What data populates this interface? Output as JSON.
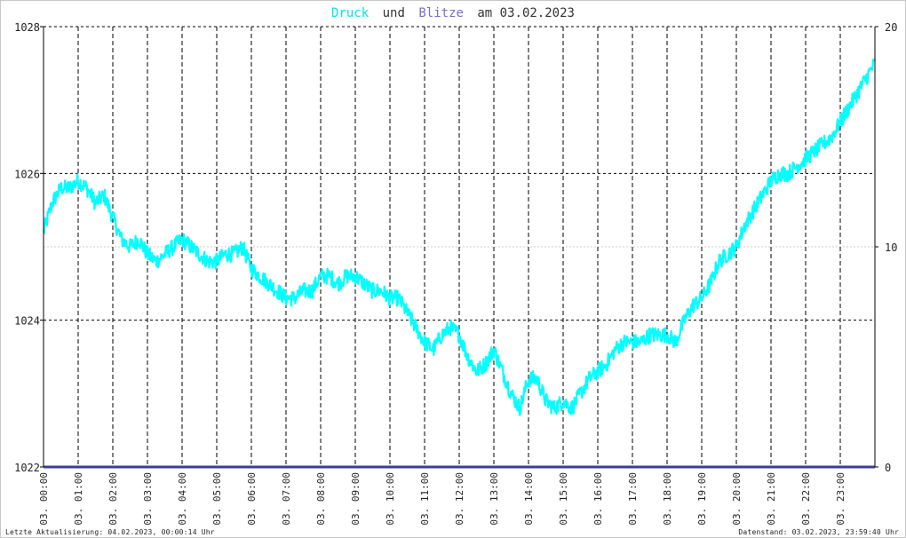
{
  "title": {
    "word1": "Druck",
    "word2": "und",
    "word3": "Blitze",
    "word4": "am 03.02.2023"
  },
  "footer": {
    "left": "Letzte Aktualisierung: 04.02.2023, 00:00:14 Uhr",
    "right": "Datenstand: 03.02.2023, 23:59:40 Uhr"
  },
  "colors": {
    "pressure": "#00ffff",
    "lightning": "#3c3c9a",
    "title_druck": "#00e6e6",
    "title_blitze": "#7b6ccc",
    "grid": "#000000",
    "axis": "#000000"
  },
  "chart_data": {
    "type": "line",
    "title": "Druck und Blitze am 03.02.2023",
    "y_left": {
      "ylim": [
        1022,
        1028
      ],
      "ticks": [
        1022,
        1024,
        1026,
        1028
      ]
    },
    "y_right": {
      "ylim": [
        0,
        20
      ],
      "ticks": [
        0,
        10,
        20
      ]
    },
    "x_ticks": [
      "03. 00:00",
      "03. 01:00",
      "03. 02:00",
      "03. 03:00",
      "03. 04:00",
      "03. 05:00",
      "03. 06:00",
      "03. 07:00",
      "03. 08:00",
      "03. 09:00",
      "03. 10:00",
      "03. 11:00",
      "03. 12:00",
      "03. 13:00",
      "03. 14:00",
      "03. 15:00",
      "03. 16:00",
      "03. 17:00",
      "03. 18:00",
      "03. 19:00",
      "03. 20:00",
      "03. 21:00",
      "03. 22:00",
      "03. 23:00"
    ],
    "grid": true,
    "series": [
      {
        "name": "Druck",
        "axis": "left",
        "x_hours": [
          0.0,
          0.25,
          0.5,
          0.75,
          1.0,
          1.25,
          1.5,
          1.75,
          2.0,
          2.25,
          2.5,
          2.75,
          3.0,
          3.25,
          3.5,
          3.75,
          4.0,
          4.25,
          4.5,
          4.75,
          5.0,
          5.25,
          5.5,
          5.75,
          6.0,
          6.25,
          6.5,
          6.75,
          7.0,
          7.25,
          7.5,
          7.75,
          8.0,
          8.25,
          8.5,
          8.75,
          9.0,
          9.25,
          9.5,
          9.75,
          10.0,
          10.25,
          10.5,
          10.75,
          11.0,
          11.25,
          11.5,
          11.75,
          12.0,
          12.25,
          12.5,
          12.75,
          13.0,
          13.25,
          13.5,
          13.75,
          14.0,
          14.25,
          14.5,
          14.75,
          15.0,
          15.25,
          15.5,
          15.75,
          16.0,
          16.25,
          16.5,
          16.75,
          17.0,
          17.25,
          17.5,
          17.75,
          18.0,
          18.25,
          18.5,
          18.75,
          19.0,
          19.25,
          19.5,
          19.75,
          20.0,
          20.25,
          20.5,
          20.75,
          21.0,
          21.25,
          21.5,
          21.75,
          22.0,
          22.25,
          22.5,
          22.75,
          23.0,
          23.25,
          23.5,
          23.75,
          24.0
        ],
        "values": [
          1025.2,
          1025.6,
          1025.8,
          1025.8,
          1025.9,
          1025.8,
          1025.6,
          1025.7,
          1025.4,
          1025.1,
          1025.0,
          1025.1,
          1024.9,
          1024.8,
          1024.9,
          1025.0,
          1025.1,
          1025.0,
          1024.9,
          1024.8,
          1024.8,
          1024.9,
          1024.9,
          1025.0,
          1024.7,
          1024.6,
          1024.5,
          1024.4,
          1024.3,
          1024.3,
          1024.4,
          1024.4,
          1024.6,
          1024.6,
          1024.5,
          1024.6,
          1024.6,
          1024.5,
          1024.4,
          1024.4,
          1024.3,
          1024.3,
          1024.1,
          1023.9,
          1023.7,
          1023.6,
          1023.8,
          1023.9,
          1023.8,
          1023.5,
          1023.3,
          1023.4,
          1023.6,
          1023.3,
          1023.0,
          1022.8,
          1023.2,
          1023.2,
          1022.9,
          1022.8,
          1022.9,
          1022.8,
          1023.0,
          1023.2,
          1023.3,
          1023.4,
          1023.6,
          1023.7,
          1023.7,
          1023.7,
          1023.8,
          1023.8,
          1023.8,
          1023.7,
          1024.0,
          1024.2,
          1024.3,
          1024.5,
          1024.8,
          1024.9,
          1025.0,
          1025.3,
          1025.5,
          1025.7,
          1025.9,
          1026.0,
          1026.0,
          1026.1,
          1026.2,
          1026.3,
          1026.4,
          1026.5,
          1026.7,
          1026.9,
          1027.1,
          1027.3,
          1027.5
        ]
      },
      {
        "name": "Blitze",
        "axis": "right",
        "x_hours": [
          0,
          24
        ],
        "values": [
          0,
          0
        ]
      }
    ]
  }
}
